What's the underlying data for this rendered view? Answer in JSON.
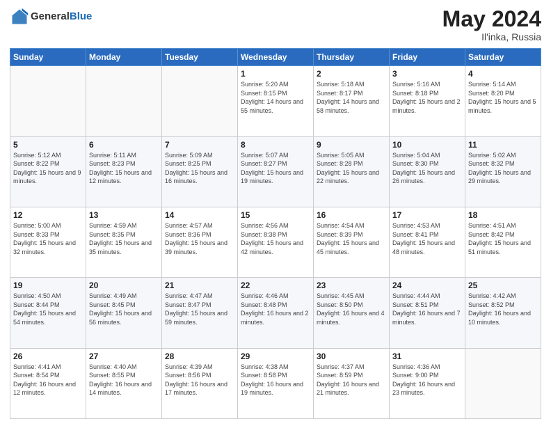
{
  "logo": {
    "general": "General",
    "blue": "Blue"
  },
  "header": {
    "month_year": "May 2024",
    "location": "Il'inka, Russia"
  },
  "weekdays": [
    "Sunday",
    "Monday",
    "Tuesday",
    "Wednesday",
    "Thursday",
    "Friday",
    "Saturday"
  ],
  "weeks": [
    [
      {
        "day": "",
        "sunrise": "",
        "sunset": "",
        "daylight": ""
      },
      {
        "day": "",
        "sunrise": "",
        "sunset": "",
        "daylight": ""
      },
      {
        "day": "",
        "sunrise": "",
        "sunset": "",
        "daylight": ""
      },
      {
        "day": "1",
        "sunrise": "Sunrise: 5:20 AM",
        "sunset": "Sunset: 8:15 PM",
        "daylight": "Daylight: 14 hours and 55 minutes."
      },
      {
        "day": "2",
        "sunrise": "Sunrise: 5:18 AM",
        "sunset": "Sunset: 8:17 PM",
        "daylight": "Daylight: 14 hours and 58 minutes."
      },
      {
        "day": "3",
        "sunrise": "Sunrise: 5:16 AM",
        "sunset": "Sunset: 8:18 PM",
        "daylight": "Daylight: 15 hours and 2 minutes."
      },
      {
        "day": "4",
        "sunrise": "Sunrise: 5:14 AM",
        "sunset": "Sunset: 8:20 PM",
        "daylight": "Daylight: 15 hours and 5 minutes."
      }
    ],
    [
      {
        "day": "5",
        "sunrise": "Sunrise: 5:12 AM",
        "sunset": "Sunset: 8:22 PM",
        "daylight": "Daylight: 15 hours and 9 minutes."
      },
      {
        "day": "6",
        "sunrise": "Sunrise: 5:11 AM",
        "sunset": "Sunset: 8:23 PM",
        "daylight": "Daylight: 15 hours and 12 minutes."
      },
      {
        "day": "7",
        "sunrise": "Sunrise: 5:09 AM",
        "sunset": "Sunset: 8:25 PM",
        "daylight": "Daylight: 15 hours and 16 minutes."
      },
      {
        "day": "8",
        "sunrise": "Sunrise: 5:07 AM",
        "sunset": "Sunset: 8:27 PM",
        "daylight": "Daylight: 15 hours and 19 minutes."
      },
      {
        "day": "9",
        "sunrise": "Sunrise: 5:05 AM",
        "sunset": "Sunset: 8:28 PM",
        "daylight": "Daylight: 15 hours and 22 minutes."
      },
      {
        "day": "10",
        "sunrise": "Sunrise: 5:04 AM",
        "sunset": "Sunset: 8:30 PM",
        "daylight": "Daylight: 15 hours and 26 minutes."
      },
      {
        "day": "11",
        "sunrise": "Sunrise: 5:02 AM",
        "sunset": "Sunset: 8:32 PM",
        "daylight": "Daylight: 15 hours and 29 minutes."
      }
    ],
    [
      {
        "day": "12",
        "sunrise": "Sunrise: 5:00 AM",
        "sunset": "Sunset: 8:33 PM",
        "daylight": "Daylight: 15 hours and 32 minutes."
      },
      {
        "day": "13",
        "sunrise": "Sunrise: 4:59 AM",
        "sunset": "Sunset: 8:35 PM",
        "daylight": "Daylight: 15 hours and 35 minutes."
      },
      {
        "day": "14",
        "sunrise": "Sunrise: 4:57 AM",
        "sunset": "Sunset: 8:36 PM",
        "daylight": "Daylight: 15 hours and 39 minutes."
      },
      {
        "day": "15",
        "sunrise": "Sunrise: 4:56 AM",
        "sunset": "Sunset: 8:38 PM",
        "daylight": "Daylight: 15 hours and 42 minutes."
      },
      {
        "day": "16",
        "sunrise": "Sunrise: 4:54 AM",
        "sunset": "Sunset: 8:39 PM",
        "daylight": "Daylight: 15 hours and 45 minutes."
      },
      {
        "day": "17",
        "sunrise": "Sunrise: 4:53 AM",
        "sunset": "Sunset: 8:41 PM",
        "daylight": "Daylight: 15 hours and 48 minutes."
      },
      {
        "day": "18",
        "sunrise": "Sunrise: 4:51 AM",
        "sunset": "Sunset: 8:42 PM",
        "daylight": "Daylight: 15 hours and 51 minutes."
      }
    ],
    [
      {
        "day": "19",
        "sunrise": "Sunrise: 4:50 AM",
        "sunset": "Sunset: 8:44 PM",
        "daylight": "Daylight: 15 hours and 54 minutes."
      },
      {
        "day": "20",
        "sunrise": "Sunrise: 4:49 AM",
        "sunset": "Sunset: 8:45 PM",
        "daylight": "Daylight: 15 hours and 56 minutes."
      },
      {
        "day": "21",
        "sunrise": "Sunrise: 4:47 AM",
        "sunset": "Sunset: 8:47 PM",
        "daylight": "Daylight: 15 hours and 59 minutes."
      },
      {
        "day": "22",
        "sunrise": "Sunrise: 4:46 AM",
        "sunset": "Sunset: 8:48 PM",
        "daylight": "Daylight: 16 hours and 2 minutes."
      },
      {
        "day": "23",
        "sunrise": "Sunrise: 4:45 AM",
        "sunset": "Sunset: 8:50 PM",
        "daylight": "Daylight: 16 hours and 4 minutes."
      },
      {
        "day": "24",
        "sunrise": "Sunrise: 4:44 AM",
        "sunset": "Sunset: 8:51 PM",
        "daylight": "Daylight: 16 hours and 7 minutes."
      },
      {
        "day": "25",
        "sunrise": "Sunrise: 4:42 AM",
        "sunset": "Sunset: 8:52 PM",
        "daylight": "Daylight: 16 hours and 10 minutes."
      }
    ],
    [
      {
        "day": "26",
        "sunrise": "Sunrise: 4:41 AM",
        "sunset": "Sunset: 8:54 PM",
        "daylight": "Daylight: 16 hours and 12 minutes."
      },
      {
        "day": "27",
        "sunrise": "Sunrise: 4:40 AM",
        "sunset": "Sunset: 8:55 PM",
        "daylight": "Daylight: 16 hours and 14 minutes."
      },
      {
        "day": "28",
        "sunrise": "Sunrise: 4:39 AM",
        "sunset": "Sunset: 8:56 PM",
        "daylight": "Daylight: 16 hours and 17 minutes."
      },
      {
        "day": "29",
        "sunrise": "Sunrise: 4:38 AM",
        "sunset": "Sunset: 8:58 PM",
        "daylight": "Daylight: 16 hours and 19 minutes."
      },
      {
        "day": "30",
        "sunrise": "Sunrise: 4:37 AM",
        "sunset": "Sunset: 8:59 PM",
        "daylight": "Daylight: 16 hours and 21 minutes."
      },
      {
        "day": "31",
        "sunrise": "Sunrise: 4:36 AM",
        "sunset": "Sunset: 9:00 PM",
        "daylight": "Daylight: 16 hours and 23 minutes."
      },
      {
        "day": "",
        "sunrise": "",
        "sunset": "",
        "daylight": ""
      }
    ]
  ]
}
